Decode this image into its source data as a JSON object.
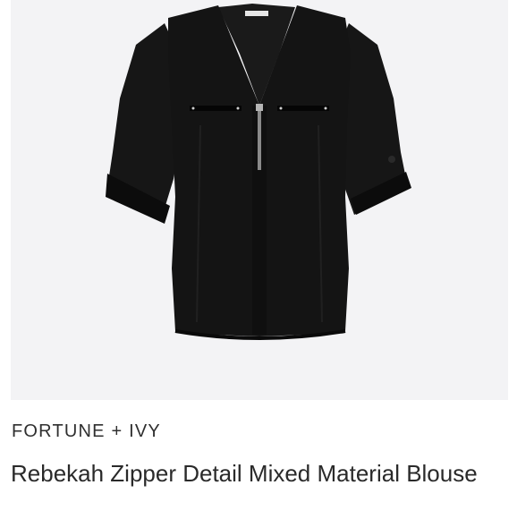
{
  "product": {
    "brand": "FORTUNE + IVY",
    "title": "Rebekah Zipper Detail Mixed Material Blouse",
    "image_subject": "black-blouse"
  },
  "colors": {
    "image_background": "#f3f3f5",
    "garment": "#121212",
    "text": "#2a2a2a"
  }
}
